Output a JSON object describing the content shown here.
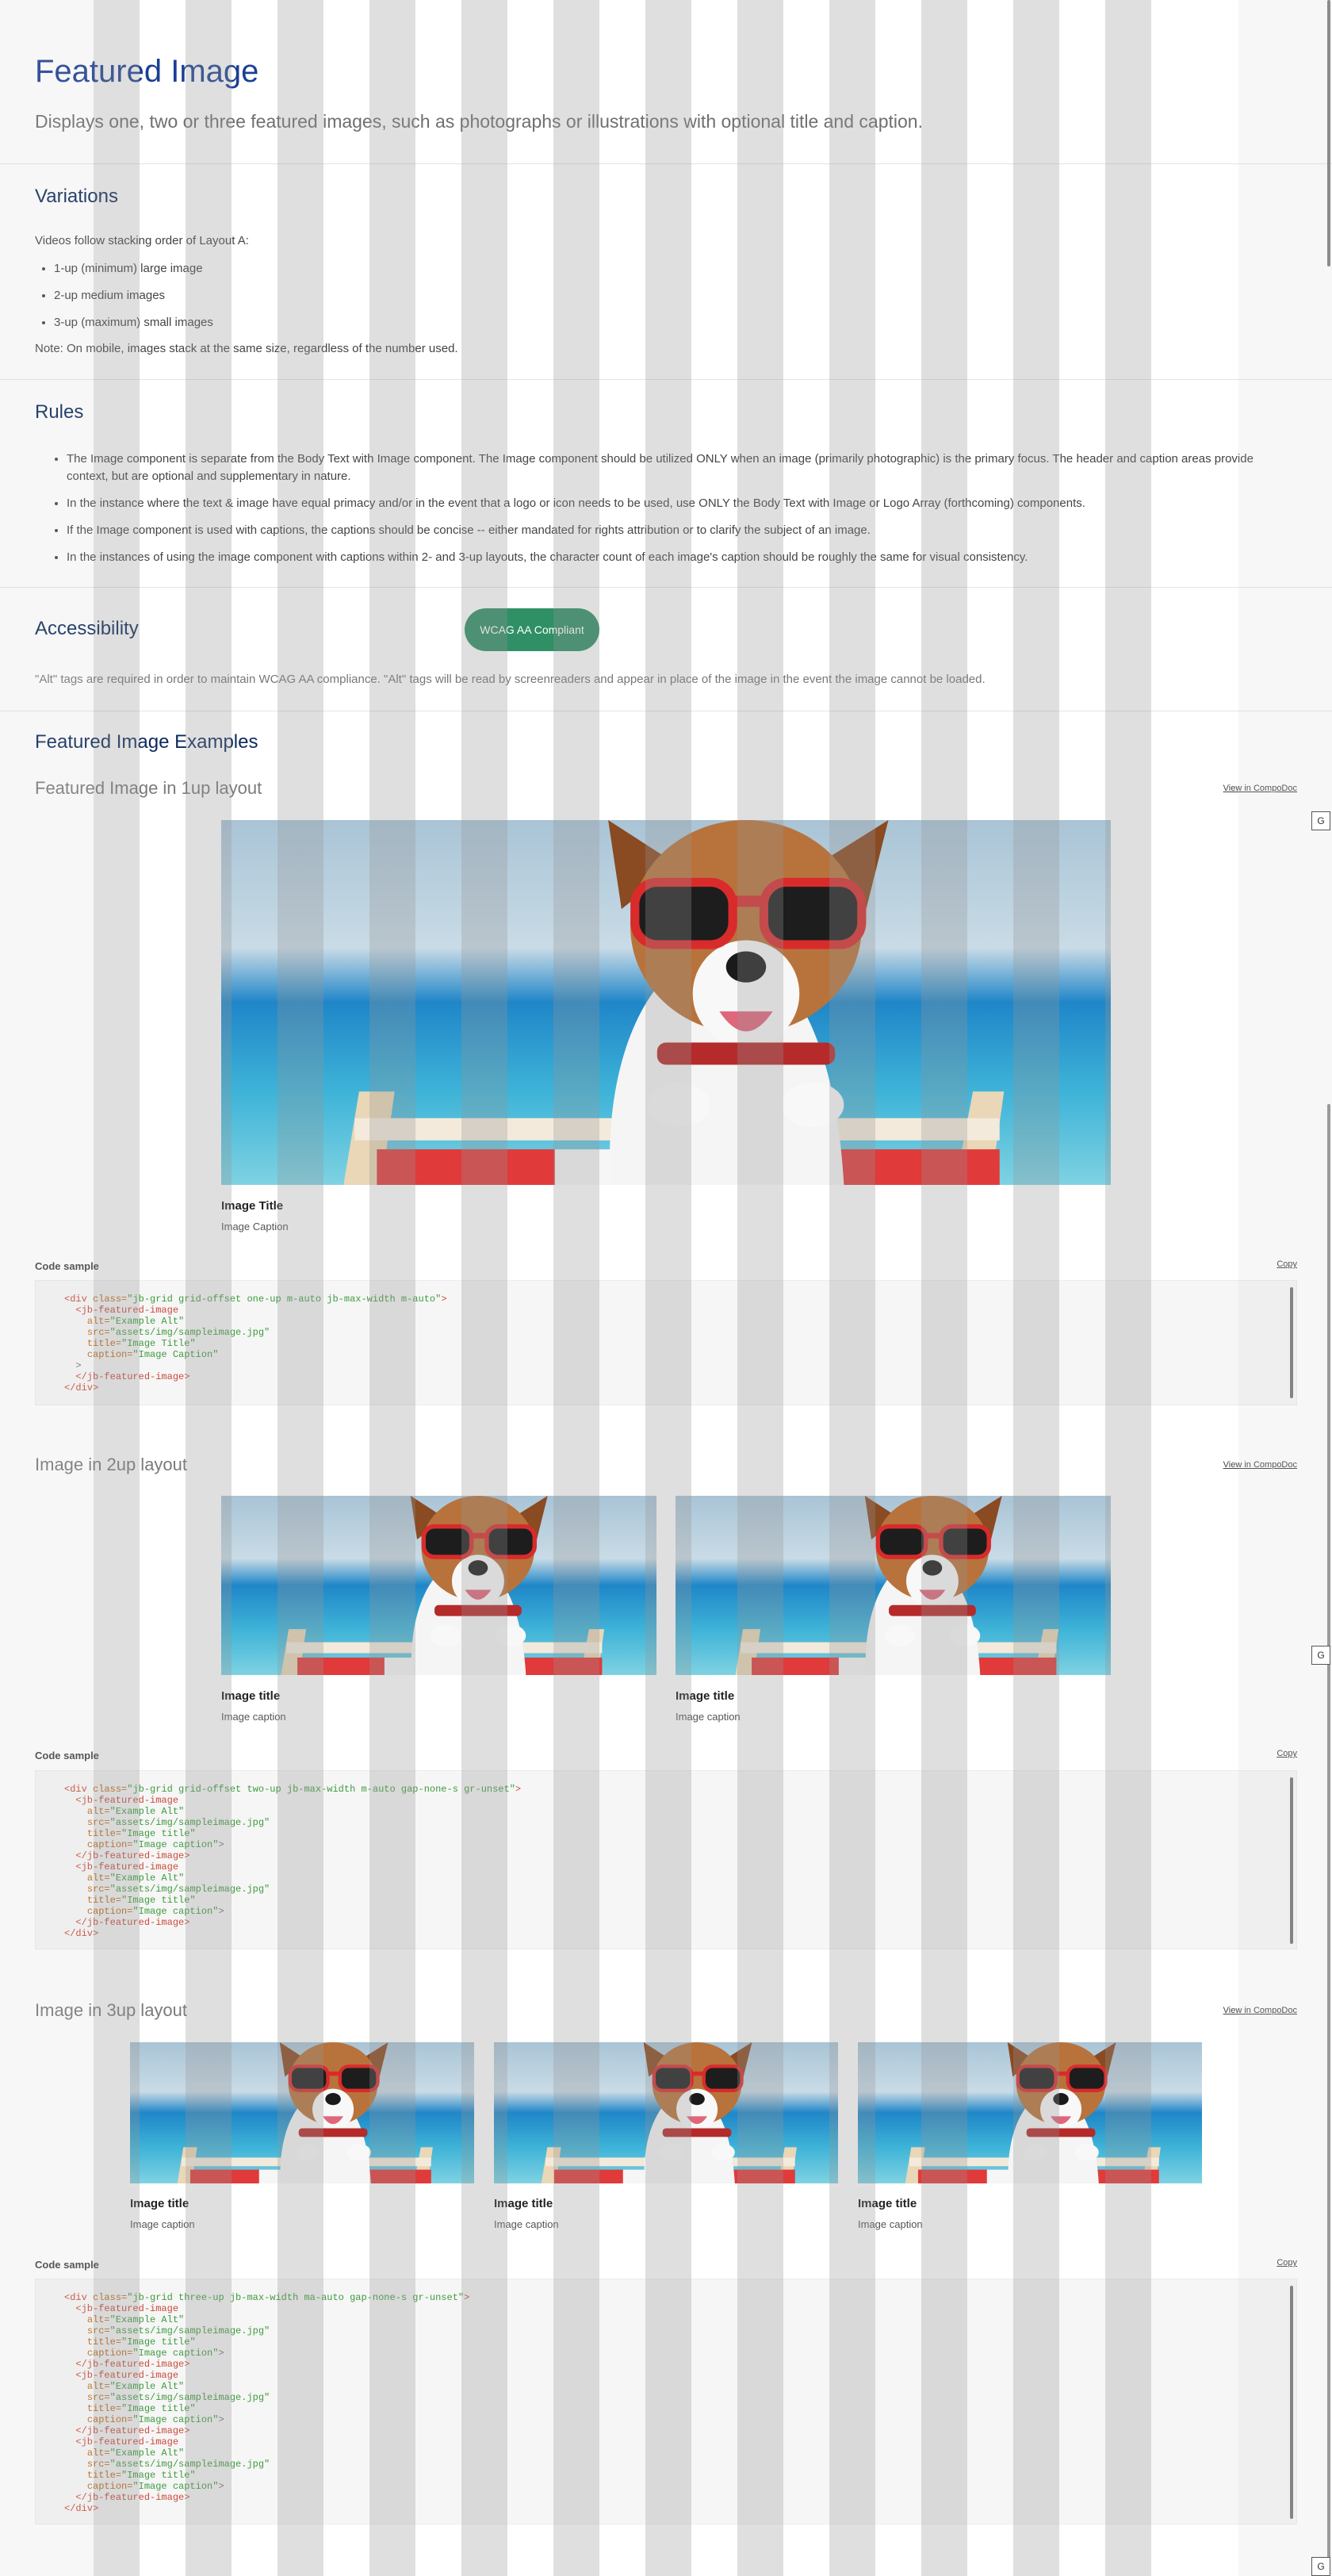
{
  "header": {
    "title": "Featured Image",
    "subtitle": "Displays one, two or three featured images, such as photographs or illustrations with optional title and caption."
  },
  "variations": {
    "title": "Variations",
    "intro": "Videos follow stacking order of Layout A:",
    "items": [
      "1-up (minimum) large image",
      "2-up medium images",
      "3-up (maximum) small images"
    ],
    "note": "Note: On mobile, images stack at the same size, regardless of the number used."
  },
  "rules": {
    "title": "Rules",
    "items": [
      "The Image component is separate from the Body Text with Image component. The Image component should be utilized ONLY when an image (primarily photographic) is the primary focus. The header and caption areas provide context, but are optional and supplementary in nature.",
      "In the instance where the text & image have equal primacy and/or in the event that a logo or icon needs to be used, use ONLY the Body Text with Image or Logo Array (forthcoming) components.",
      "If the Image component is used with captions, the captions should be concise -- either mandated for rights attribution or to clarify the subject of an image.",
      "In the instances of using the image component with captions within 2- and 3-up layouts, the character count of each image's caption should be roughly the same for visual consistency."
    ]
  },
  "accessibility": {
    "title": "Accessibility",
    "badge": "WCAG AA Compliant",
    "text": "\"Alt\" tags are required in order to maintain WCAG AA compliance. \"Alt\" tags will be read by screenreaders and appear in place of the image in the event the image cannot be loaded."
  },
  "examples": {
    "title": "Featured Image Examples",
    "view_label": "View in CompoDoc",
    "g_label": "G",
    "code_label": "Code sample",
    "copy_label": "Copy",
    "one_up": {
      "heading": "Featured Image in 1up layout",
      "images": [
        {
          "title": "Image Title",
          "caption": "Image Caption"
        }
      ],
      "code": [
        [
          [
            "tag",
            "<div "
          ],
          [
            "attr",
            "class="
          ],
          [
            "val",
            "\"jb-grid grid-offset one-up m-auto jb-max-width m-auto\""
          ],
          [
            "tag",
            ">"
          ]
        ],
        [
          [
            "plain",
            "  "
          ],
          [
            "tag",
            "<jb-featured-image"
          ]
        ],
        [
          [
            "plain",
            "    "
          ],
          [
            "attr",
            "alt="
          ],
          [
            "val",
            "\"Example Alt\""
          ]
        ],
        [
          [
            "plain",
            "    "
          ],
          [
            "attr",
            "src="
          ],
          [
            "val",
            "\"assets/img/sampleimage.jpg\""
          ]
        ],
        [
          [
            "plain",
            "    "
          ],
          [
            "attr",
            "title="
          ],
          [
            "val",
            "\"Image Title\""
          ]
        ],
        [
          [
            "plain",
            "    "
          ],
          [
            "attr",
            "caption="
          ],
          [
            "val",
            "\"Image Caption\""
          ]
        ],
        [
          [
            "plain",
            "  >"
          ]
        ],
        [
          [
            "plain",
            "  "
          ],
          [
            "tag",
            "</jb-featured-image>"
          ]
        ],
        [
          [
            "tag",
            "</div>"
          ]
        ]
      ]
    },
    "two_up": {
      "heading": "Image in 2up layout",
      "images": [
        {
          "title": "Image title",
          "caption": "Image caption"
        },
        {
          "title": "Image title",
          "caption": "Image caption"
        }
      ],
      "code": [
        [
          [
            "tag",
            "<div "
          ],
          [
            "attr",
            "class="
          ],
          [
            "val",
            "\"jb-grid grid-offset two-up jb-max-width m-auto gap-none-s gr-unset\""
          ],
          [
            "tag",
            ">"
          ]
        ],
        [
          [
            "plain",
            "  "
          ],
          [
            "tag",
            "<jb-featured-image"
          ]
        ],
        [
          [
            "plain",
            "    "
          ],
          [
            "attr",
            "alt="
          ],
          [
            "val",
            "\"Example Alt\""
          ]
        ],
        [
          [
            "plain",
            "    "
          ],
          [
            "attr",
            "src="
          ],
          [
            "val",
            "\"assets/img/sampleimage.jpg\""
          ]
        ],
        [
          [
            "plain",
            "    "
          ],
          [
            "attr",
            "title="
          ],
          [
            "val",
            "\"Image title\""
          ]
        ],
        [
          [
            "plain",
            "    "
          ],
          [
            "attr",
            "caption="
          ],
          [
            "val",
            "\"Image caption\""
          ],
          [
            "plain",
            ">"
          ]
        ],
        [
          [
            "plain",
            "  "
          ],
          [
            "tag",
            "</jb-featured-image>"
          ]
        ],
        [
          [
            "plain",
            "  "
          ],
          [
            "tag",
            "<jb-featured-image"
          ]
        ],
        [
          [
            "plain",
            "    "
          ],
          [
            "attr",
            "alt="
          ],
          [
            "val",
            "\"Example Alt\""
          ]
        ],
        [
          [
            "plain",
            "    "
          ],
          [
            "attr",
            "src="
          ],
          [
            "val",
            "\"assets/img/sampleimage.jpg\""
          ]
        ],
        [
          [
            "plain",
            "    "
          ],
          [
            "attr",
            "title="
          ],
          [
            "val",
            "\"Image title\""
          ]
        ],
        [
          [
            "plain",
            "    "
          ],
          [
            "attr",
            "caption="
          ],
          [
            "val",
            "\"Image caption\""
          ],
          [
            "plain",
            ">"
          ]
        ],
        [
          [
            "plain",
            "  "
          ],
          [
            "tag",
            "</jb-featured-image>"
          ]
        ],
        [
          [
            "tag",
            "</div>"
          ]
        ]
      ]
    },
    "three_up": {
      "heading": "Image in 3up layout",
      "images": [
        {
          "title": "Image title",
          "caption": "Image caption"
        },
        {
          "title": "Image title",
          "caption": "Image caption"
        },
        {
          "title": "Image title",
          "caption": "Image caption"
        }
      ],
      "code": [
        [
          [
            "tag",
            "<div "
          ],
          [
            "attr",
            "class="
          ],
          [
            "val",
            "\"jb-grid three-up jb-max-width ma-auto gap-none-s gr-unset\""
          ],
          [
            "tag",
            ">"
          ]
        ],
        [
          [
            "plain",
            "  "
          ],
          [
            "tag",
            "<jb-featured-image"
          ]
        ],
        [
          [
            "plain",
            "    "
          ],
          [
            "attr",
            "alt="
          ],
          [
            "val",
            "\"Example Alt\""
          ]
        ],
        [
          [
            "plain",
            "    "
          ],
          [
            "attr",
            "src="
          ],
          [
            "val",
            "\"assets/img/sampleimage.jpg\""
          ]
        ],
        [
          [
            "plain",
            "    "
          ],
          [
            "attr",
            "title="
          ],
          [
            "val",
            "\"Image title\""
          ]
        ],
        [
          [
            "plain",
            "    "
          ],
          [
            "attr",
            "caption="
          ],
          [
            "val",
            "\"Image caption\""
          ],
          [
            "plain",
            ">"
          ]
        ],
        [
          [
            "plain",
            "  "
          ],
          [
            "tag",
            "</jb-featured-image>"
          ]
        ],
        [
          [
            "plain",
            "  "
          ],
          [
            "tag",
            "<jb-featured-image"
          ]
        ],
        [
          [
            "plain",
            "    "
          ],
          [
            "attr",
            "alt="
          ],
          [
            "val",
            "\"Example Alt\""
          ]
        ],
        [
          [
            "plain",
            "    "
          ],
          [
            "attr",
            "src="
          ],
          [
            "val",
            "\"assets/img/sampleimage.jpg\""
          ]
        ],
        [
          [
            "plain",
            "    "
          ],
          [
            "attr",
            "title="
          ],
          [
            "val",
            "\"Image title\""
          ]
        ],
        [
          [
            "plain",
            "    "
          ],
          [
            "attr",
            "caption="
          ],
          [
            "val",
            "\"Image caption\""
          ],
          [
            "plain",
            ">"
          ]
        ],
        [
          [
            "plain",
            "  "
          ],
          [
            "tag",
            "</jb-featured-image>"
          ]
        ],
        [
          [
            "plain",
            "  "
          ],
          [
            "tag",
            "<jb-featured-image"
          ]
        ],
        [
          [
            "plain",
            "    "
          ],
          [
            "attr",
            "alt="
          ],
          [
            "val",
            "\"Example Alt\""
          ]
        ],
        [
          [
            "plain",
            "    "
          ],
          [
            "attr",
            "src="
          ],
          [
            "val",
            "\"assets/img/sampleimage.jpg\""
          ]
        ],
        [
          [
            "plain",
            "    "
          ],
          [
            "attr",
            "title="
          ],
          [
            "val",
            "\"Image title\""
          ]
        ],
        [
          [
            "plain",
            "    "
          ],
          [
            "attr",
            "caption="
          ],
          [
            "val",
            "\"Image caption\""
          ],
          [
            "plain",
            ">"
          ]
        ],
        [
          [
            "plain",
            "  "
          ],
          [
            "tag",
            "</jb-featured-image>"
          ]
        ],
        [
          [
            "tag",
            "</div>"
          ]
        ]
      ]
    }
  },
  "colors": {
    "title_blue": "#1c3f94",
    "section_navy": "#0b2a5b",
    "badge_green": "#2f8f65",
    "code_tag": "#c94a3a",
    "code_value": "#3f9b3f"
  },
  "icons": {
    "photo": "dog-with-sunglasses-photo",
    "g": "g-icon"
  }
}
